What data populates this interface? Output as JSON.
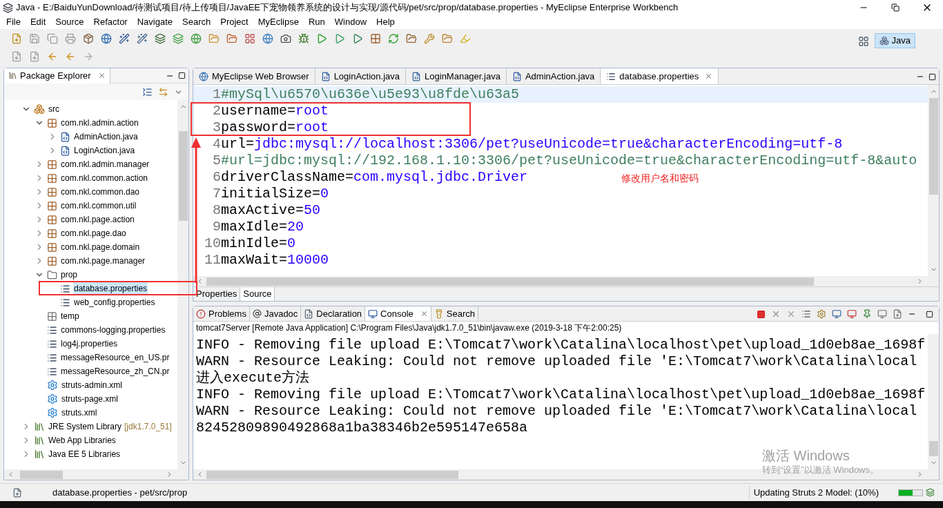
{
  "window": {
    "title": "Java - E:/BaiduYunDownload/待测试项目/待上传项目/JavaEE下宠物领养系统的设计与实现/源代码/pet/src/prop/database.properties - MyEclipse Enterprise Workbench"
  },
  "menu": [
    "File",
    "Edit",
    "Source",
    "Refactor",
    "Navigate",
    "Search",
    "Project",
    "MyEclipse",
    "Run",
    "Window",
    "Help"
  ],
  "perspective": {
    "label": "Java",
    "selected": true
  },
  "package_explorer": {
    "title": "Package Explorer",
    "tree": [
      {
        "label": "src",
        "kind": "source-folder",
        "expanded": true,
        "selected": false,
        "children": [
          {
            "label": "com.nkl.admin.action",
            "kind": "package",
            "expanded": true,
            "selected": false,
            "children": [
              {
                "label": "AdminAction.java",
                "kind": "java",
                "expanded": false,
                "selected": false
              },
              {
                "label": "LoginAction.java",
                "kind": "java",
                "expanded": false,
                "selected": false
              }
            ]
          },
          {
            "label": "com.nkl.admin.manager",
            "kind": "package",
            "expanded": false,
            "selected": false
          },
          {
            "label": "com.nkl.common.action",
            "kind": "package",
            "expanded": false,
            "selected": false
          },
          {
            "label": "com.nkl.common.dao",
            "kind": "package",
            "expanded": false,
            "selected": false
          },
          {
            "label": "com.nkl.common.util",
            "kind": "package",
            "expanded": false,
            "selected": false
          },
          {
            "label": "com.nkl.page.action",
            "kind": "package",
            "expanded": false,
            "selected": false
          },
          {
            "label": "com.nkl.page.dao",
            "kind": "package",
            "expanded": false,
            "selected": false
          },
          {
            "label": "com.nkl.page.domain",
            "kind": "package",
            "expanded": false,
            "selected": false
          },
          {
            "label": "com.nkl.page.manager",
            "kind": "package",
            "expanded": false,
            "selected": false
          },
          {
            "label": "prop",
            "kind": "folder",
            "expanded": true,
            "selected": false,
            "children": [
              {
                "label": "database.properties",
                "kind": "properties",
                "selected": true
              },
              {
                "label": "web_config.properties",
                "kind": "properties",
                "selected": false
              }
            ]
          },
          {
            "label": "temp",
            "kind": "empty-package",
            "selected": false
          },
          {
            "label": "commons-logging.properties",
            "kind": "properties",
            "selected": false
          },
          {
            "label": "log4j.properties",
            "kind": "properties",
            "selected": false
          },
          {
            "label": "messageResource_en_US.pr",
            "kind": "properties",
            "selected": false
          },
          {
            "label": "messageResource_zh_CN.pr",
            "kind": "properties",
            "selected": false
          },
          {
            "label": "struts-admin.xml",
            "kind": "xml",
            "selected": false
          },
          {
            "label": "struts-page.xml",
            "kind": "xml",
            "selected": false
          },
          {
            "label": "struts.xml",
            "kind": "xml",
            "selected": false
          }
        ]
      },
      {
        "label": "JRE System Library",
        "decoration": "[jdk1.7.0_51]",
        "kind": "library",
        "expanded": false,
        "selected": false
      },
      {
        "label": "Web App Libraries",
        "kind": "library",
        "expanded": false,
        "selected": false
      },
      {
        "label": "Java EE 5 Libraries",
        "kind": "library",
        "expanded": false,
        "selected": false
      }
    ]
  },
  "editor": {
    "tabs": [
      {
        "label": "MyEclipse Web Browser",
        "kind": "browser",
        "selected": false
      },
      {
        "label": "LoginAction.java",
        "kind": "java",
        "selected": false
      },
      {
        "label": "LoginManager.java",
        "kind": "java",
        "selected": false
      },
      {
        "label": "AdminAction.java",
        "kind": "java",
        "selected": false
      },
      {
        "label": "database.properties",
        "kind": "properties",
        "selected": true
      }
    ],
    "lines": [
      {
        "number": "1",
        "kind": "comment",
        "text": "#mySql\\u6570\\u636e\\u5e93\\u8fde\\u63a5",
        "current": true
      },
      {
        "number": "2",
        "kind": "property",
        "key": "username=",
        "value": "root",
        "current": false
      },
      {
        "number": "3",
        "kind": "property",
        "key": "password=",
        "value": "root",
        "current": false
      },
      {
        "number": "4",
        "kind": "property",
        "key": "url=",
        "value": "jdbc:mysql://localhost:3306/pet?useUnicode=true&characterEncoding=utf-8",
        "current": false
      },
      {
        "number": "5",
        "kind": "comment",
        "text": "#url=jdbc:mysql://192.168.1.10:3306/pet?useUnicode=true&characterEncoding=utf-8&auto",
        "current": false
      },
      {
        "number": "6",
        "kind": "property",
        "key": "driverClassName=",
        "value": "com.mysql.jdbc.Driver",
        "current": false
      },
      {
        "number": "7",
        "kind": "property",
        "key": "initialSize=",
        "value": "0",
        "current": false
      },
      {
        "number": "8",
        "kind": "property",
        "key": "maxActive=",
        "value": "50",
        "current": false
      },
      {
        "number": "9",
        "kind": "property",
        "key": "maxIdle=",
        "value": "20",
        "current": false
      },
      {
        "number": "10",
        "kind": "property",
        "key": "minIdle=",
        "value": "0",
        "current": false
      },
      {
        "number": "11",
        "kind": "property",
        "key": "maxWait=",
        "value": "10000",
        "current": false
      }
    ],
    "bottom_tabs": [
      {
        "label": "Properties",
        "selected": false
      },
      {
        "label": "Source",
        "selected": true
      }
    ]
  },
  "console": {
    "tabs": [
      {
        "label": "Problems",
        "kind": "problems",
        "selected": false
      },
      {
        "label": "Javadoc",
        "kind": "javadoc",
        "selected": false
      },
      {
        "label": "Declaration",
        "kind": "declaration",
        "selected": false
      },
      {
        "label": "Console",
        "kind": "console",
        "selected": true
      },
      {
        "label": "Search",
        "kind": "search",
        "selected": false
      }
    ],
    "process": "tomcat7Server [Remote Java Application] C:\\Program Files\\Java\\jdk1.7.0_51\\bin\\javaw.exe (2019-3-18 下午2:00:25)",
    "lines": [
      "INFO - Removing file upload E:\\Tomcat7\\work\\Catalina\\localhost\\pet\\upload_1d0eb8ae_1698f",
      "WARN - Resource Leaking:  Could not remove uploaded file 'E:\\Tomcat7\\work\\Catalina\\local",
      "进入execute方法",
      "INFO - Removing file upload E:\\Tomcat7\\work\\Catalina\\localhost\\pet\\upload_1d0eb8ae_1698f",
      "WARN - Resource Leaking:  Could not remove uploaded file 'E:\\Tomcat7\\work\\Catalina\\local",
      "82452809890492868a1ba38346b2e595147e658a"
    ]
  },
  "annotation": {
    "note": "修改用户名和密码"
  },
  "activation_notice": {
    "title": "激活 Windows",
    "subtitle": "转到“设置”以激活 Windows。"
  },
  "status_bar": {
    "selection": "database.properties - pet/src/prop",
    "task": "Updating Struts 2 Model: (10%)",
    "progress": {
      "level": 0.6
    }
  }
}
